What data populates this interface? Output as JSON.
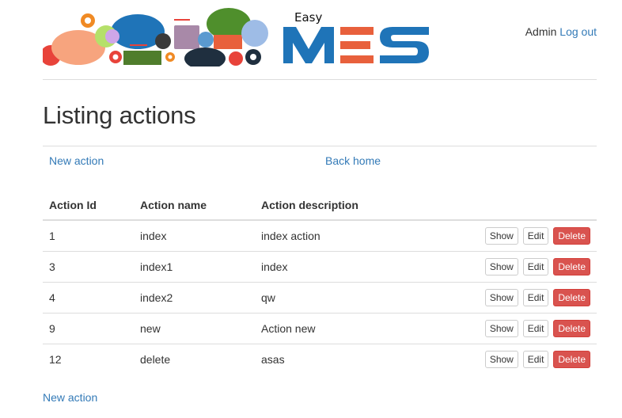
{
  "header": {
    "brand_small": "Easy",
    "user_name": "Admin",
    "logout_label": "Log out",
    "colors": {
      "brand_blue": "#1f74b8",
      "brand_orange": "#e8603c"
    }
  },
  "page": {
    "title": "Listing actions",
    "new_action_label": "New action",
    "back_home_label": "Back home",
    "bottom_new_action_label": "New action"
  },
  "table": {
    "headers": [
      "Action Id",
      "Action name",
      "Action description"
    ],
    "rows": [
      {
        "id": "1",
        "name": "index",
        "description": "index action"
      },
      {
        "id": "3",
        "name": "index1",
        "description": "index"
      },
      {
        "id": "4",
        "name": "index2",
        "description": "qw"
      },
      {
        "id": "9",
        "name": "new",
        "description": "Action new"
      },
      {
        "id": "12",
        "name": "delete",
        "description": "asas"
      }
    ],
    "buttons": {
      "show": "Show",
      "edit": "Edit",
      "delete": "Delete"
    }
  }
}
